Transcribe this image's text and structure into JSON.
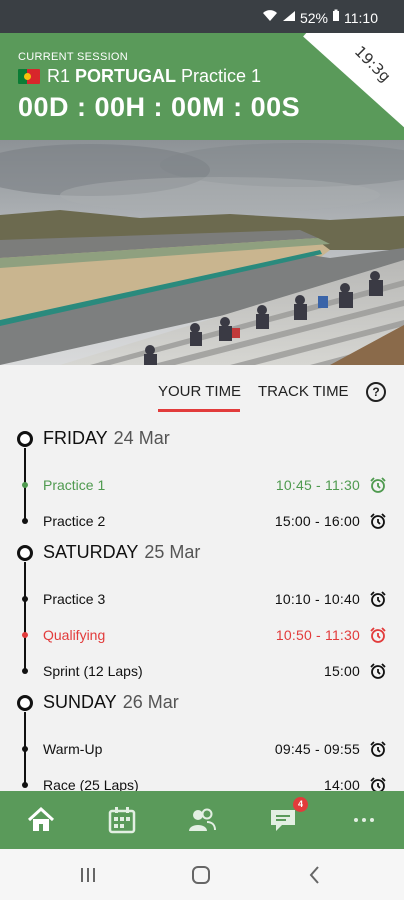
{
  "status_bar": {
    "battery": "52%",
    "time": "11:10"
  },
  "session": {
    "label": "CURRENT SESSION",
    "round": "R1",
    "country": "PORTUGAL",
    "session_name": "Practice 1",
    "countdown": "00D : 00H : 00M : 00S",
    "corner_text": "19:3g"
  },
  "tabs": {
    "your_time": "YOUR TIME",
    "track_time": "TRACK TIME",
    "help": "?"
  },
  "days": [
    {
      "name": "FRIDAY",
      "date": "24 Mar",
      "sessions": [
        {
          "label": "Practice 1",
          "time": "10:45 - 11:30",
          "state": "live"
        },
        {
          "label": "Practice 2",
          "time": "15:00 - 16:00",
          "state": "normal"
        }
      ]
    },
    {
      "name": "SATURDAY",
      "date": "25 Mar",
      "sessions": [
        {
          "label": "Practice 3",
          "time": "10:10 - 10:40",
          "state": "normal"
        },
        {
          "label": "Qualifying",
          "time": "10:50 - 11:30",
          "state": "highlight"
        },
        {
          "label": "Sprint (12 Laps)",
          "time": "15:00",
          "state": "normal"
        }
      ]
    },
    {
      "name": "SUNDAY",
      "date": "26 Mar",
      "sessions": [
        {
          "label": "Warm-Up",
          "time": "09:45 - 09:55",
          "state": "normal"
        },
        {
          "label": "Race (25 Laps)",
          "time": "14:00",
          "state": "normal"
        }
      ]
    }
  ],
  "bottom_nav": {
    "items": [
      "home-icon",
      "calendar-icon",
      "riders-icon",
      "chat-icon",
      "more-icon"
    ],
    "chat_badge": "4"
  },
  "colors": {
    "brand_green": "#5a9a5a",
    "live_green": "#4f9a4f",
    "accent_red": "#e23b3b"
  }
}
